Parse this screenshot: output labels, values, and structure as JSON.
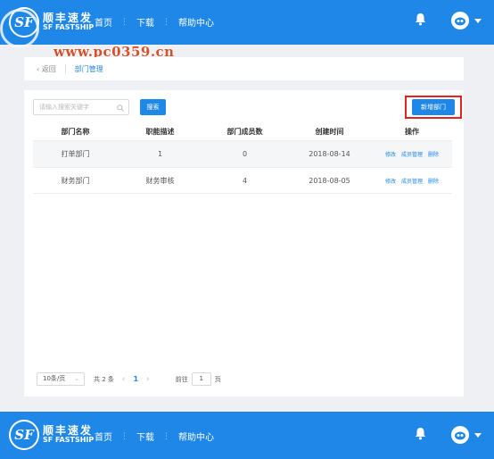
{
  "header": {
    "logo_cn": "顺丰速发",
    "logo_en": "SF FASTSHIP",
    "logo_mark": "SF",
    "nav": [
      "首页",
      "下载",
      "帮助中心"
    ]
  },
  "watermark": "www.pc0359.cn",
  "breadcrumb": {
    "back": "返回",
    "current": "部门管理"
  },
  "search": {
    "placeholder": "请输入搜索关键字",
    "button": "搜索"
  },
  "add_button": "新增部门",
  "table": {
    "headers": [
      "部门名称",
      "职能描述",
      "部门成员数",
      "创建时间",
      "操作"
    ],
    "rows": [
      {
        "name": "打单部门",
        "desc": "1",
        "members": "0",
        "created": "2018-08-14"
      },
      {
        "name": "财务部门",
        "desc": "财务审核",
        "members": "4",
        "created": "2018-08-05"
      }
    ],
    "actions": [
      "修改",
      "成员管理",
      "删除"
    ]
  },
  "pagination": {
    "page_size": "10条/页",
    "total": "共 2 条",
    "current_page": "1",
    "goto_label": "前往",
    "goto_value": "1",
    "page_suffix": "页"
  },
  "footer": {
    "logo_cn": "顺丰速发",
    "logo_en": "SF FASTSHIP",
    "logo_mark": "SF",
    "nav": [
      "首页",
      "下载",
      "帮助中心"
    ]
  },
  "colors": {
    "brand_blue": "#1e87e8",
    "highlight_red": "#e0251c",
    "background": "#eef0f4"
  },
  "icons": [
    "bell-icon",
    "avatar-icon",
    "search-icon",
    "chevron-left-icon",
    "chevron-right-icon"
  ]
}
